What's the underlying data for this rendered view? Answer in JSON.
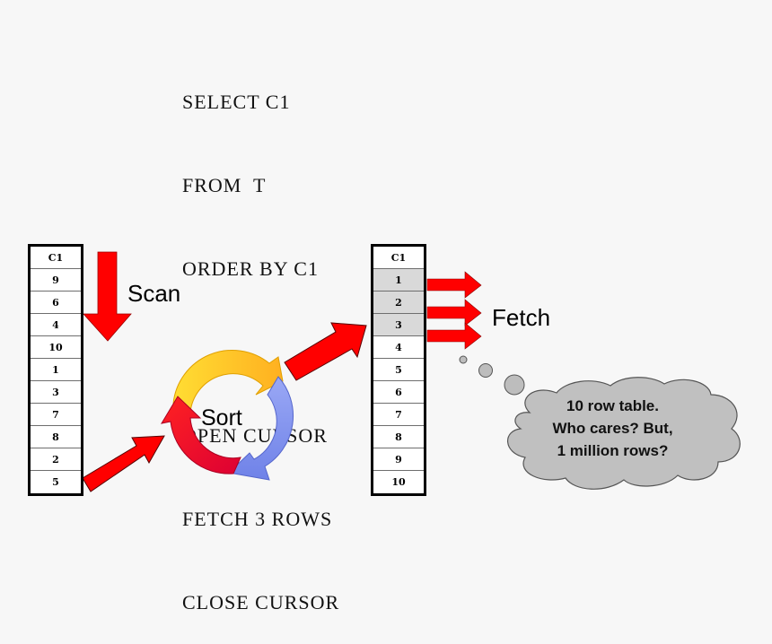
{
  "sql_lines": [
    "SELECT C1",
    "FROM  T",
    "ORDER BY C1",
    "",
    "OPEN CURSOR",
    "FETCH 3 ROWS",
    "CLOSE CURSOR"
  ],
  "left_table": {
    "header": "C1",
    "rows": [
      "9",
      "6",
      "4",
      "10",
      "1",
      "3",
      "7",
      "8",
      "2",
      "5"
    ]
  },
  "right_table": {
    "header": "C1",
    "rows": [
      "1",
      "2",
      "3",
      "4",
      "5",
      "6",
      "7",
      "8",
      "9",
      "10"
    ],
    "highlighted_count": 3
  },
  "labels": {
    "scan": "Scan",
    "sort": "Sort",
    "fetch": "Fetch"
  },
  "thought_bubble": {
    "lines": [
      "10 row table.",
      "Who cares? But,",
      "1 million rows?"
    ]
  },
  "colors": {
    "arrow_red": "#ff0000",
    "highlight_gray": "#d9d9d9",
    "cloud_gray": "#c0c0c0",
    "sort_yellow": "#ffcc22",
    "sort_blue": "#8899ee",
    "sort_red": "#ee1122"
  }
}
